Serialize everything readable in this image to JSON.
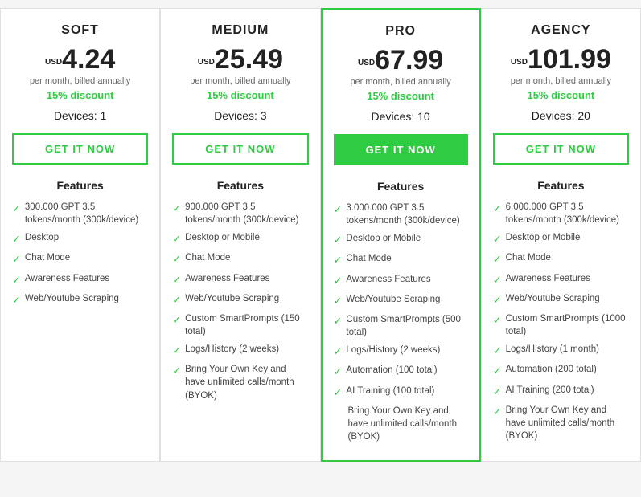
{
  "plans": [
    {
      "id": "soft",
      "name": "SOFT",
      "currency": "USD",
      "price": "4.24",
      "billed": "per month, billed annually",
      "discount": "15% discount",
      "devices": "Devices: 1",
      "btn_label": "GET IT NOW",
      "featured": false,
      "features_title": "Features",
      "features": [
        {
          "text": "300.000 GPT 3.5 tokens/month (300k/device)",
          "check": true
        },
        {
          "text": "Desktop",
          "check": true
        },
        {
          "text": "Chat Mode",
          "check": true
        },
        {
          "text": "Awareness Features",
          "check": true
        },
        {
          "text": "Web/Youtube Scraping",
          "check": true
        }
      ]
    },
    {
      "id": "medium",
      "name": "MEDIUM",
      "currency": "USD",
      "price": "25.49",
      "billed": "per month, billed annually",
      "discount": "15% discount",
      "devices": "Devices: 3",
      "btn_label": "GET IT NOW",
      "featured": false,
      "features_title": "Features",
      "features": [
        {
          "text": "900.000 GPT 3.5 tokens/month (300k/device)",
          "check": true
        },
        {
          "text": "Desktop or Mobile",
          "check": true
        },
        {
          "text": "Chat Mode",
          "check": true
        },
        {
          "text": "Awareness Features",
          "check": true
        },
        {
          "text": "Web/Youtube Scraping",
          "check": true
        },
        {
          "text": "Custom SmartPrompts (150 total)",
          "check": true
        },
        {
          "text": "Logs/History (2 weeks)",
          "check": true
        },
        {
          "text": "Bring Your Own Key and have unlimited calls/month (BYOK)",
          "check": true
        }
      ]
    },
    {
      "id": "pro",
      "name": "PRO",
      "currency": "USD",
      "price": "67.99",
      "billed": "per month, billed annually",
      "discount": "15% discount",
      "devices": "Devices: 10",
      "btn_label": "GET IT NOW",
      "featured": true,
      "features_title": "Features",
      "features": [
        {
          "text": "3.000.000 GPT 3.5 tokens/month (300k/device)",
          "check": true
        },
        {
          "text": "Desktop or Mobile",
          "check": true
        },
        {
          "text": "Chat Mode",
          "check": true
        },
        {
          "text": "Awareness Features",
          "check": true
        },
        {
          "text": "Web/Youtube Scraping",
          "check": true
        },
        {
          "text": "Custom SmartPrompts (500 total)",
          "check": true
        },
        {
          "text": "Logs/History (2 weeks)",
          "check": true
        },
        {
          "text": "Automation (100 total)",
          "check": true
        },
        {
          "text": "AI Training (100 total)",
          "check": true
        },
        {
          "text": "Bring Your Own Key and have unlimited calls/month (BYOK)",
          "check": false
        }
      ]
    },
    {
      "id": "agency",
      "name": "AGENCY",
      "currency": "USD",
      "price": "101.99",
      "billed": "per month, billed annually",
      "discount": "15% discount",
      "devices": "Devices: 20",
      "btn_label": "GET IT NOW",
      "featured": false,
      "features_title": "Features",
      "features": [
        {
          "text": "6.000.000 GPT 3.5 tokens/month (300k/device)",
          "check": true
        },
        {
          "text": "Desktop or Mobile",
          "check": true
        },
        {
          "text": "Chat Mode",
          "check": true
        },
        {
          "text": "Awareness Features",
          "check": true
        },
        {
          "text": "Web/Youtube Scraping",
          "check": true
        },
        {
          "text": "Custom SmartPrompts (1000 total)",
          "check": true
        },
        {
          "text": "Logs/History (1 month)",
          "check": true
        },
        {
          "text": "Automation (200 total)",
          "check": true
        },
        {
          "text": "AI Training (200 total)",
          "check": true
        },
        {
          "text": "Bring Your Own Key and have unlimited calls/month (BYOK)",
          "check": true
        }
      ]
    }
  ]
}
